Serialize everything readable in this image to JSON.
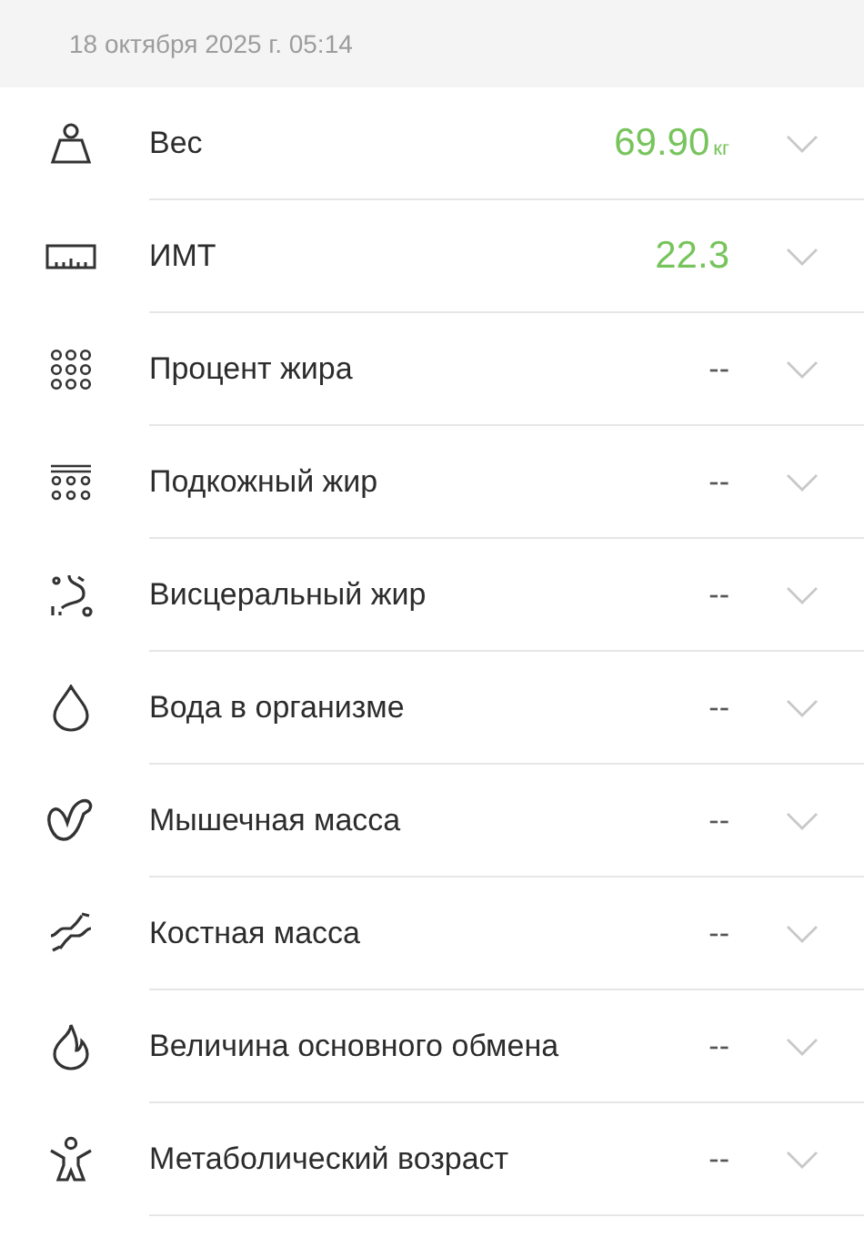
{
  "header": {
    "date": "18 октября 2025 г. 05:14"
  },
  "metrics": [
    {
      "kind": "weight",
      "label": "Вес",
      "value": "69.90",
      "unit": "кг",
      "measured": true,
      "expanded": false
    },
    {
      "kind": "ruler",
      "label": "ИМТ",
      "value": "22.3",
      "measured": true,
      "expanded": false
    },
    {
      "kind": "dots",
      "label": "Процент жира",
      "value": "--",
      "measured": false,
      "expanded": false
    },
    {
      "kind": "skin",
      "label": "Подкожный жир",
      "value": "--",
      "measured": false,
      "expanded": false
    },
    {
      "kind": "organ",
      "label": "Висцеральный жир",
      "value": "--",
      "measured": false,
      "expanded": false
    },
    {
      "kind": "drop",
      "label": "Вода в организме",
      "value": "--",
      "measured": false,
      "expanded": false
    },
    {
      "kind": "muscle",
      "label": "Мышечная масса",
      "value": "--",
      "measured": false,
      "expanded": false
    },
    {
      "kind": "bone",
      "label": "Костная масса",
      "value": "--",
      "measured": false,
      "expanded": false
    },
    {
      "kind": "flame",
      "label": "Величина основного обмена",
      "value": "--",
      "measured": false,
      "expanded": false
    },
    {
      "kind": "body",
      "label": "Метаболический возраст",
      "value": "--",
      "measured": false,
      "expanded": false
    }
  ]
}
